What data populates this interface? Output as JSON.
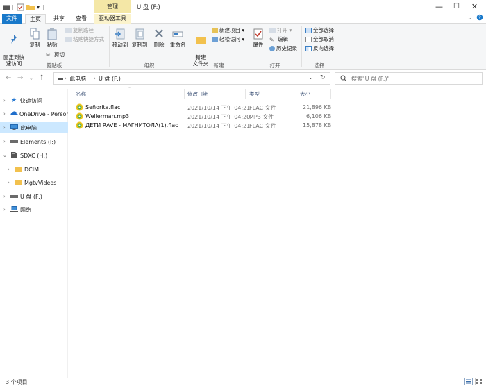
{
  "window": {
    "title": "U 盘 (F:)",
    "context_tab": "管理",
    "min_glyph": "—",
    "max_glyph": "☐",
    "close_glyph": "✕"
  },
  "tabs": [
    {
      "label": "文件"
    },
    {
      "label": "主页"
    },
    {
      "label": "共享"
    },
    {
      "label": "查看"
    },
    {
      "label": "驱动器工具"
    }
  ],
  "ribbon": {
    "clipboard": {
      "pin": "固定到快\n速访问",
      "copy": "复制",
      "paste": "粘贴",
      "copy_path": "复制路径",
      "paste_shortcut": "粘贴快捷方式",
      "cut": "剪切",
      "group": "剪贴板"
    },
    "organize": {
      "move_to": "移动到",
      "copy_to": "复制到",
      "delete": "删除",
      "rename": "重命名",
      "group": "组织"
    },
    "new": {
      "new_folder": "新建\n文件夹",
      "new_item": "新建项目 ▾",
      "easy_access": "轻松访问 ▾",
      "group": "新建"
    },
    "open": {
      "properties": "属性",
      "open": "打开 ▾",
      "edit": "编辑",
      "history": "历史记录",
      "group": "打开"
    },
    "select": {
      "select_all": "全部选择",
      "select_none": "全部取消",
      "invert": "反向选择",
      "group": "选择"
    }
  },
  "address": {
    "crumbs": [
      "此电脑",
      "U 盘 (F:)"
    ],
    "search_placeholder": "搜索\"U 盘 (F:)\""
  },
  "nav": [
    {
      "label": "快速访问",
      "icon": "star-icon"
    },
    {
      "label": "OneDrive - Personal",
      "icon": "cloud-icon"
    },
    {
      "label": "此电脑",
      "icon": "computer-icon"
    },
    {
      "label": "Elements (I:)",
      "icon": "drive-icon"
    },
    {
      "label": "SDXC (H:)",
      "icon": "sd-card-icon"
    },
    {
      "label": "DCIM",
      "icon": "folder-icon"
    },
    {
      "label": "MgtvVideos",
      "icon": "folder-icon"
    },
    {
      "label": "U 盘 (F:)",
      "icon": "drive-icon"
    },
    {
      "label": "网络",
      "icon": "network-icon"
    }
  ],
  "columns": {
    "name": "名称",
    "date": "修改日期",
    "type": "类型",
    "size": "大小"
  },
  "files": [
    {
      "name": "Señorita.flac",
      "date": "2021/10/14 下午 04:21",
      "type": "FLAC 文件",
      "size": "21,896 KB"
    },
    {
      "name": "Wellerman.mp3",
      "date": "2021/10/14 下午 04:20",
      "type": "MP3 文件",
      "size": "6,106 KB"
    },
    {
      "name": "ДЕТИ RAVE - МАГНИТОЛА(1).flac",
      "date": "2021/10/14 下午 04:21",
      "type": "FLAC 文件",
      "size": "15,878 KB"
    }
  ],
  "status": {
    "count": "3 个项目"
  },
  "colors": {
    "accent": "#1979ca",
    "context": "#f4e7a6",
    "selection": "#cce8ff"
  }
}
